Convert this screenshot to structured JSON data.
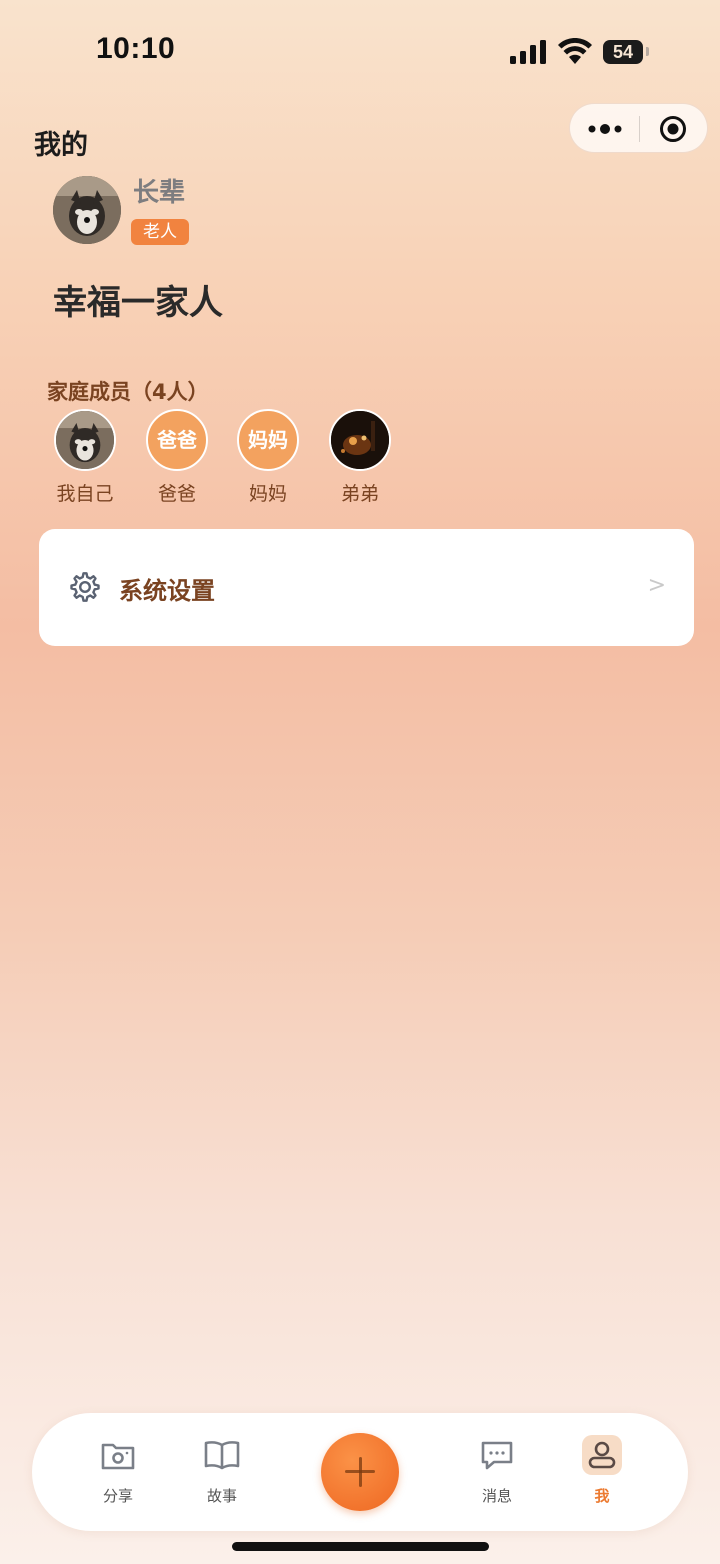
{
  "status_bar": {
    "time": "10:10",
    "battery": "54"
  },
  "header": {
    "title": "我的"
  },
  "profile": {
    "name": "长辈",
    "role_badge": "老人",
    "family_name": "幸福一家人"
  },
  "members": {
    "title": "家庭成员（4人）",
    "items": [
      {
        "label": "我自己",
        "avatar_type": "photo",
        "avatar_text": ""
      },
      {
        "label": "爸爸",
        "avatar_type": "text",
        "avatar_text": "爸爸"
      },
      {
        "label": "妈妈",
        "avatar_type": "text",
        "avatar_text": "妈妈"
      },
      {
        "label": "弟弟",
        "avatar_type": "photo",
        "avatar_text": ""
      }
    ]
  },
  "settings": {
    "label": "系统设置",
    "chevron": ">",
    "icon": "gear-icon"
  },
  "tab_bar": {
    "items": [
      {
        "label": "分享",
        "icon": "camera-folder-icon",
        "active": false
      },
      {
        "label": "故事",
        "icon": "book-icon",
        "active": false
      },
      {
        "label": "",
        "icon": "plus-icon",
        "active": false
      },
      {
        "label": "消息",
        "icon": "message-icon",
        "active": false
      },
      {
        "label": "我",
        "icon": "user-icon",
        "active": true
      }
    ]
  },
  "colors": {
    "accent": "#f2742d",
    "brown_text": "#7a4321",
    "badge": "#f1833f"
  }
}
